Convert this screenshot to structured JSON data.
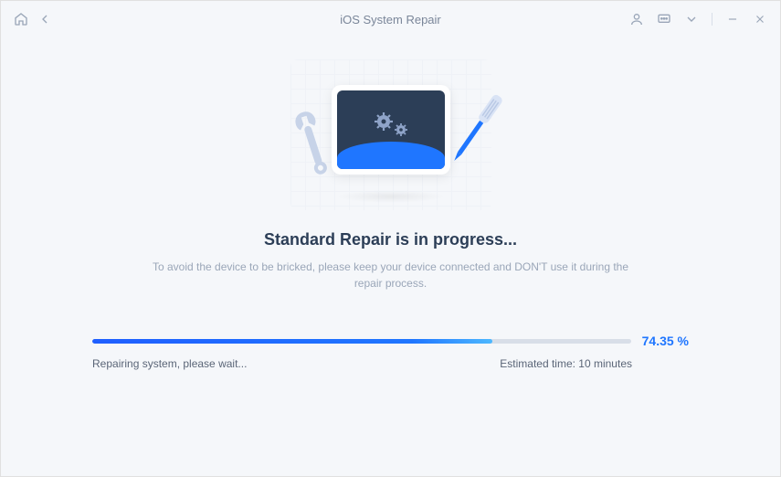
{
  "titlebar": {
    "title": "iOS System Repair"
  },
  "main": {
    "heading": "Standard Repair is in progress...",
    "subtext": "To avoid the device to be bricked, please keep your device connected and DON'T use it during the repair process."
  },
  "progress": {
    "percent_label": "74.35 %",
    "percent_value": 74.35,
    "status": "Repairing system, please wait...",
    "eta_label": "Estimated time: 10 minutes"
  }
}
